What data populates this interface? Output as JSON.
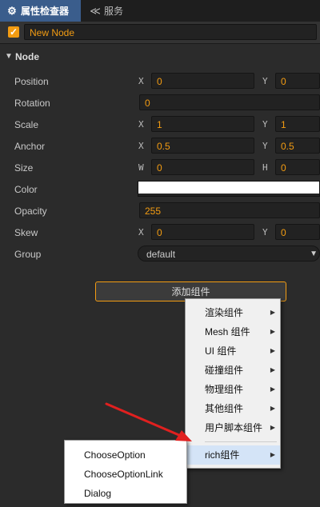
{
  "tabs": [
    {
      "label": "属性检查器",
      "icon": "gear-icon"
    },
    {
      "label": "服务",
      "icon": "service-icon"
    }
  ],
  "node": {
    "enabled": true,
    "name": "New Node"
  },
  "section": {
    "title": "Node"
  },
  "properties": {
    "position": {
      "label": "Position",
      "x_axis": "X",
      "y_axis": "Y",
      "x": "0",
      "y": "0"
    },
    "rotation": {
      "label": "Rotation",
      "value": "0"
    },
    "scale": {
      "label": "Scale",
      "x_axis": "X",
      "y_axis": "Y",
      "x": "1",
      "y": "1"
    },
    "anchor": {
      "label": "Anchor",
      "x_axis": "X",
      "y_axis": "Y",
      "x": "0.5",
      "y": "0.5"
    },
    "size": {
      "label": "Size",
      "w_axis": "W",
      "h_axis": "H",
      "w": "0",
      "h": "0"
    },
    "color": {
      "label": "Color",
      "value": "#ffffff"
    },
    "opacity": {
      "label": "Opacity",
      "value": "255"
    },
    "skew": {
      "label": "Skew",
      "x_axis": "X",
      "y_axis": "Y",
      "x": "0",
      "y": "0"
    },
    "group": {
      "label": "Group",
      "value": "default"
    }
  },
  "add_component": {
    "label": "添加组件"
  },
  "menu": {
    "items": [
      "渲染组件",
      "Mesh 组件",
      "UI 组件",
      "碰撞组件",
      "物理组件",
      "其他组件",
      "用户脚本组件",
      "rich组件"
    ],
    "hovered": "rich组件"
  },
  "submenu": {
    "items": [
      "ChooseOption",
      "ChooseOptionLink",
      "Dialog"
    ]
  },
  "colors": {
    "accent": "#f39c12",
    "arrow": "#e0201f",
    "tab_active": "#3a5d8c"
  }
}
